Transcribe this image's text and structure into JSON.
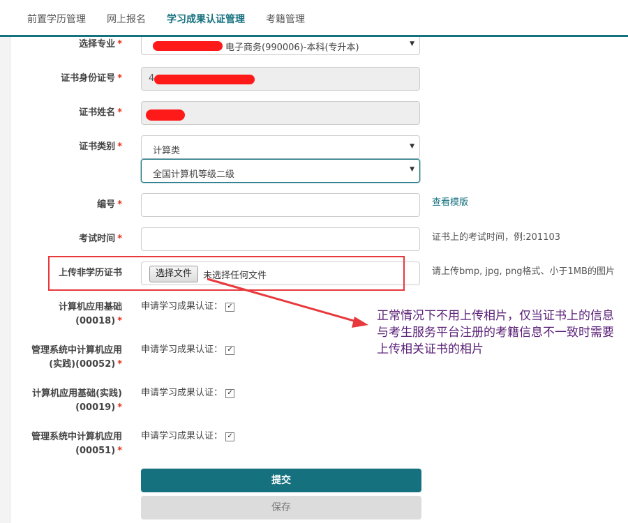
{
  "nav": {
    "tabs": [
      {
        "label": "前置学历管理"
      },
      {
        "label": "网上报名"
      },
      {
        "label": "学习成果认证管理"
      },
      {
        "label": "考籍管理"
      }
    ]
  },
  "form": {
    "major": {
      "label": "选择专业",
      "value": "电子商务(990006)-本科(专升本)"
    },
    "cert_id": {
      "label": "证书身份证号",
      "value": "4"
    },
    "cert_name": {
      "label": "证书姓名"
    },
    "cert_type": {
      "label": "证书类别",
      "value": "计算类",
      "subvalue": "全国计算机等级二级"
    },
    "number": {
      "label": "编号",
      "link": "查看模版"
    },
    "exam_time": {
      "label": "考试时间",
      "hint": "证书上的考试时间，例:201103"
    },
    "upload": {
      "label": "上传非学历证书",
      "button": "选择文件",
      "status": "未选择任何文件",
      "hint": "请上传bmp, jpg, png格式、小于1MB的图片"
    },
    "required_mark": "*",
    "courses": [
      {
        "line1": "计算机应用基础",
        "line2": "(00018)",
        "apply_label": "申请学习成果认证：",
        "checked": true
      },
      {
        "line1": "管理系统中计算机应用",
        "line2": "(实践)(00052)",
        "apply_label": "申请学习成果认证：",
        "checked": true
      },
      {
        "line1": "计算机应用基础(实践)",
        "line2": "(00019)",
        "apply_label": "申请学习成果认证：",
        "checked": true
      },
      {
        "line1": "管理系统中计算机应用",
        "line2": "(00051)",
        "apply_label": "申请学习成果认证：",
        "checked": true
      }
    ],
    "submit_label": "提交",
    "save_label": "保存"
  },
  "annotation": {
    "text": "正常情况下不用上传相片，仅当证书上的信息与考生服务平台注册的考籍信息不一致时需要上传相关证书的相片",
    "color": "#5a2077"
  },
  "colors": {
    "accent": "#16717f",
    "required": "#e0301e",
    "markup_red": "#e8383c"
  },
  "icons": {
    "dropdown": "caret-down-icon",
    "checkbox": "checkmark-icon"
  }
}
